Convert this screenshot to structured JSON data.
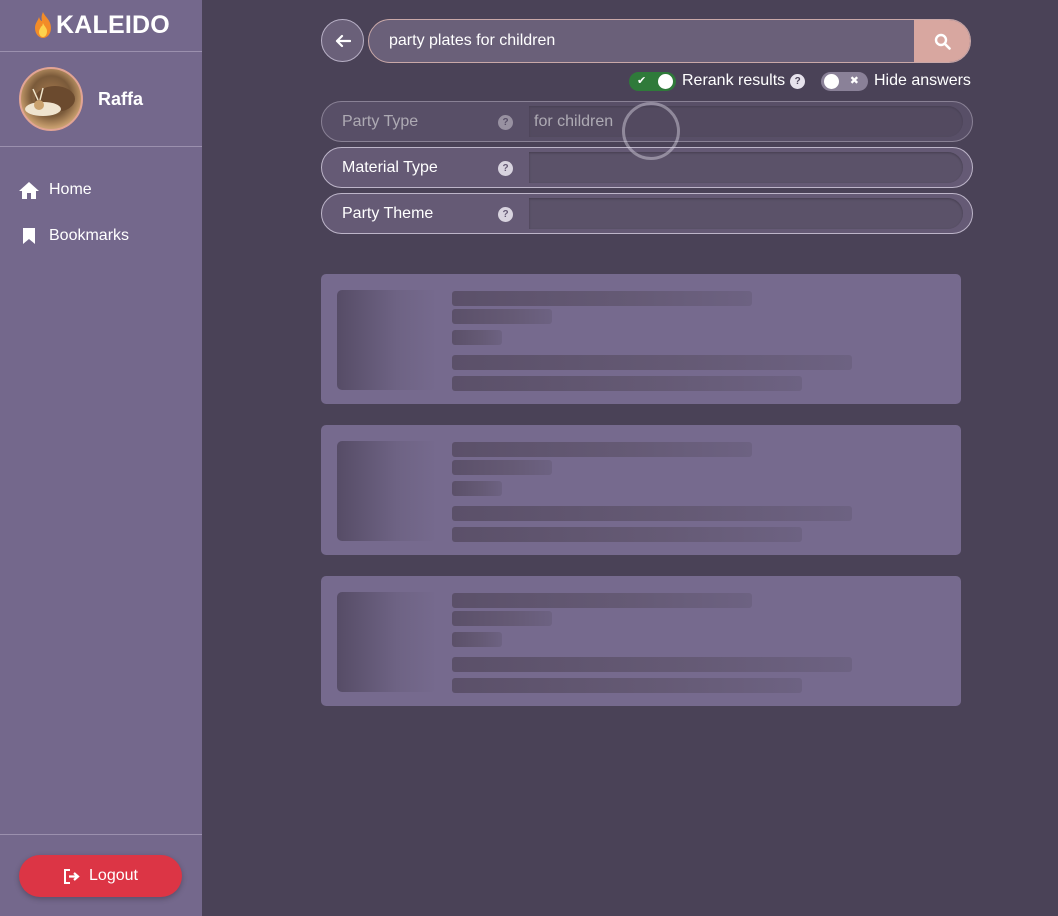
{
  "app": {
    "brand": "KALEIDO",
    "brand_icon": "fire-icon"
  },
  "user": {
    "name": "Raffa"
  },
  "nav": {
    "items": [
      {
        "label": "Home",
        "icon": "home-icon"
      },
      {
        "label": "Bookmarks",
        "icon": "bookmark-icon"
      }
    ]
  },
  "logout": {
    "label": "Logout",
    "icon": "sign-out-icon"
  },
  "search": {
    "query": "party plates for children",
    "button_icon": "search-icon",
    "back_icon": "arrow-left-icon"
  },
  "toggles": {
    "rerank": {
      "label": "Rerank results",
      "on": true,
      "help": "?"
    },
    "hide_answers": {
      "label": "Hide answers",
      "on": false
    }
  },
  "facets": [
    {
      "label": "Party Type",
      "value": "for children",
      "help": "?"
    },
    {
      "label": "Material Type",
      "value": "",
      "help": "?"
    },
    {
      "label": "Party Theme",
      "value": "",
      "help": "?"
    }
  ],
  "results": {
    "state": "loading",
    "placeholder_count": 3
  },
  "colors": {
    "sidebar": "#74688c",
    "main_bg": "#4a4257",
    "accent_search": "#d8a7a0",
    "logout": "#dc3545",
    "toggle_on": "#2f7a3a"
  }
}
